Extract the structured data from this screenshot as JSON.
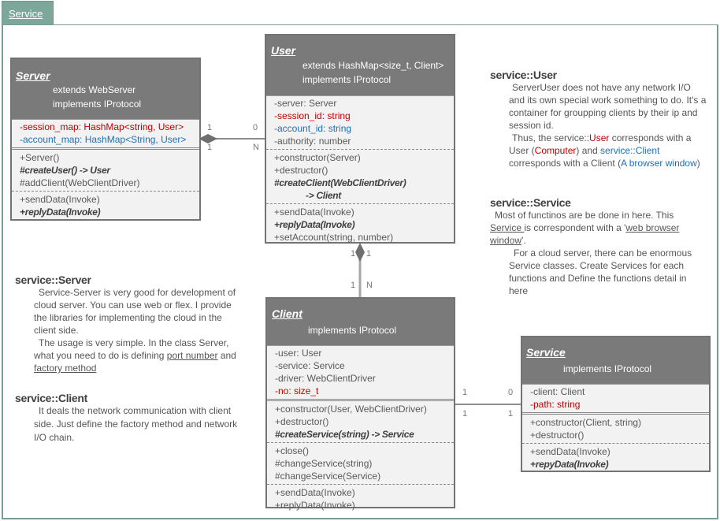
{
  "tab": {
    "label": "Service"
  },
  "classes": {
    "server": {
      "name": "Server",
      "extends": "extends WebServer",
      "implements": "implements IProtocol",
      "attributes": [
        {
          "text": "-session_map: HashMap<string, User>",
          "color": "red"
        },
        {
          "text": "-account_map: HashMap<String, User>",
          "color": "blue"
        }
      ],
      "methods_1": [
        {
          "text": "+Server()"
        },
        {
          "text": "#createUser() -> User",
          "style": "bold-italic"
        },
        {
          "text": "#addClient(WebClientDriver)"
        }
      ],
      "methods_2": [
        {
          "text": "+sendData(Invoke)"
        },
        {
          "text": "+replyData(Invoke)",
          "style": "bold-italic"
        }
      ]
    },
    "user": {
      "name": "User",
      "extends": "extends HashMap<size_t, Client>",
      "implements": "implements IProtocol",
      "attributes": [
        {
          "text": "-server: Server"
        },
        {
          "text": "-session_id: string",
          "color": "red"
        },
        {
          "text": "-account_id: string",
          "color": "blue"
        },
        {
          "text": "-authority: number"
        }
      ],
      "methods_1": [
        {
          "text": "+constructor(Server)"
        },
        {
          "text": "+destructor()"
        },
        {
          "text": "#createClient(WebClientDriver)",
          "style": "bold-italic"
        },
        {
          "text": "-> Client",
          "style": "bold-italic"
        }
      ],
      "methods_2": [
        {
          "text": "+sendData(Invoke)"
        },
        {
          "text": "+replyData(Invoke)",
          "style": "bold-italic"
        },
        {
          "text": "+setAccount(string, number)"
        }
      ]
    },
    "client": {
      "name": "Client",
      "implements": "implements IProtocol",
      "attributes": [
        {
          "text": "-user: User"
        },
        {
          "text": "-service: Service"
        },
        {
          "text": "-driver: WebClientDriver"
        },
        {
          "text": "-no: size_t",
          "color": "red"
        }
      ],
      "methods_1": [
        {
          "text": "+constructor(User, WebClientDriver)"
        },
        {
          "text": "+destructor()"
        },
        {
          "text": "#createService(string) -> Service",
          "style": "bold-italic"
        }
      ],
      "methods_2": [
        {
          "text": "+close()"
        },
        {
          "text": "#changeService(string)"
        },
        {
          "text": "#changeService(Service)"
        }
      ],
      "methods_3": [
        {
          "text": "+sendData(Invoke)"
        },
        {
          "text": "+replyData(Invoke)"
        }
      ]
    },
    "service": {
      "name": "Service",
      "implements": "implements IProtocol",
      "attributes": [
        {
          "text": "-client: Client"
        },
        {
          "text": "-path: string",
          "color": "red"
        }
      ],
      "methods_1": [
        {
          "text": "+constructor(Client, string)"
        },
        {
          "text": "+destructor()"
        }
      ],
      "methods_2": [
        {
          "text": "+sendData(Invoke)"
        },
        {
          "text": "+repyData(Invoke)",
          "style": "bold-italic"
        }
      ]
    }
  },
  "associations": {
    "server_user": {
      "a_top": "1",
      "a_bottom": "1",
      "b_top": "0",
      "b_bottom": "N"
    },
    "user_client": {
      "a_left": "1",
      "a_right": "1",
      "b_left": "1",
      "b_right": "N"
    },
    "client_service": {
      "a_top": "1",
      "a_bottom": "1",
      "b_top": "0",
      "b_bottom": "1"
    }
  },
  "notes": {
    "user": {
      "title": "service::User",
      "p1": "ServerUser does not have any network I/O and its own special work something to do. It's a container for groupping clients by their ip and session id.",
      "p2_a": "Thus, the service::",
      "p2_user": "User",
      "p2_b": " corresponds with a User (",
      "p2_computer": "Computer",
      "p2_c": ") and ",
      "p2_client": "service::Client",
      "p2_d": " corresponds with a Client (",
      "p2_browser": "A browser window",
      "p2_e": ")"
    },
    "service": {
      "title": "service::Service",
      "p1_a": "Most of functinos are be done in here. This ",
      "p1_service": "Service ",
      "p1_b": "is correspondent with a '",
      "p1_link": "web browser window",
      "p1_c": "'.",
      "p2": "For a cloud server, there can be enormous Service classes. Create Services for each functions and Define the functions detail in here"
    },
    "server": {
      "title": "service::Server",
      "p1": "Service-Server is very good for development of cloud server. You can use web or flex. I provide the libraries for implementing the cloud in the client side.",
      "p2_a": "The usage is very simple. In the class Server, what you need to do is defining ",
      "p2_port": "port number",
      "p2_b": " and ",
      "p2_factory": "factory method"
    },
    "client": {
      "title": "service::Client",
      "p1": "It deals the network communication with client side. Just define the factory method and network I/O chain."
    }
  },
  "colors": {
    "tab": "#7ea79b",
    "frame": "#7a9b91",
    "class_header": "#7a7a7a",
    "class_body": "#f2f2f2",
    "red": "#c00000",
    "blue": "#1f6fb8"
  }
}
